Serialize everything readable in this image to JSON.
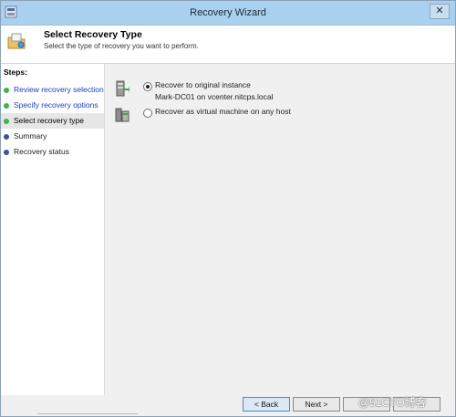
{
  "window": {
    "title": "Recovery Wizard",
    "close_label": "✕"
  },
  "header": {
    "title": "Select Recovery Type",
    "subtitle": "Select the type of recovery you want to perform."
  },
  "steps": {
    "title": "Steps:",
    "items": [
      {
        "label": "Review recovery selection",
        "state": "done"
      },
      {
        "label": "Specify recovery options",
        "state": "done"
      },
      {
        "label": "Select recovery type",
        "state": "current"
      },
      {
        "label": "Summary",
        "state": "pending"
      },
      {
        "label": "Recovery status",
        "state": "pending"
      }
    ]
  },
  "options": [
    {
      "label": "Recover to original instance",
      "detail": "Mark-DC01 on vcenter.nitcps.local",
      "selected": true,
      "icon": "server-restore-icon"
    },
    {
      "label": "Recover as virtual machine on any host",
      "detail": "",
      "selected": false,
      "icon": "vm-host-icon"
    }
  ],
  "buttons": {
    "back": "< Back",
    "next": "Next >",
    "finish": "",
    "help": ""
  },
  "watermark": "@51CTO博客",
  "colors": {
    "titlebar": "#a9d0ee",
    "done_dot": "#3fb34f",
    "pending_dot": "#3f4f99",
    "link_text": "#1b3fb6"
  }
}
